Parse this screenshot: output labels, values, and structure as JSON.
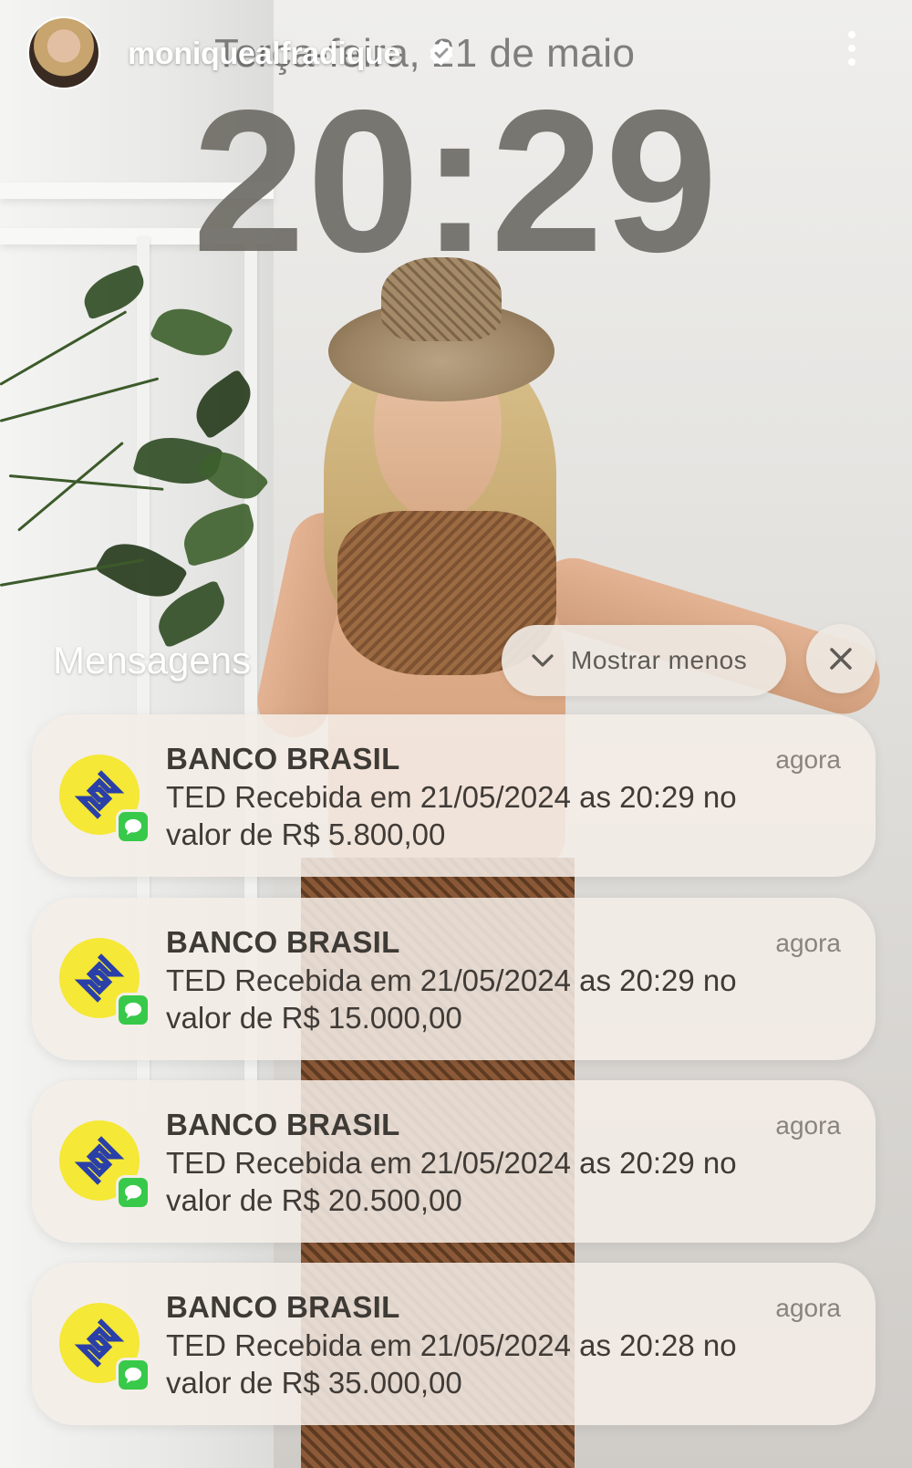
{
  "story": {
    "username": "moniquealfradique",
    "verified": true
  },
  "lock_screen": {
    "date": "Terça-feira, 21 de maio",
    "time": "20:29"
  },
  "notifications_section": {
    "title": "Mensagens",
    "show_less_label": "Mostrar menos",
    "items": [
      {
        "sender": "BANCO BRASIL",
        "time": "agora",
        "message": "TED Recebida em 21/05/2024 as 20:29 no valor de R$ 5.800,00"
      },
      {
        "sender": "BANCO BRASIL",
        "time": "agora",
        "message": "TED Recebida em 21/05/2024 as 20:29 no valor de R$ 15.000,00"
      },
      {
        "sender": "BANCO BRASIL",
        "time": "agora",
        "message": "TED Recebida em 21/05/2024 as 20:29 no valor de R$ 20.500,00"
      },
      {
        "sender": "BANCO BRASIL",
        "time": "agora",
        "message": "TED Recebida em 21/05/2024 as 20:28 no valor de R$ 35.000,00"
      }
    ]
  },
  "colors": {
    "bank_icon_bg": "#f5e836",
    "bank_icon_mark": "#2a3fa8",
    "messages_badge": "#38c94a"
  },
  "icons": {
    "more": "more-vertical-icon",
    "verified": "verified-badge-icon",
    "chevron": "chevron-down-icon",
    "close": "close-icon",
    "bank": "banco-do-brasil-logo-icon",
    "messages": "messages-app-icon"
  }
}
